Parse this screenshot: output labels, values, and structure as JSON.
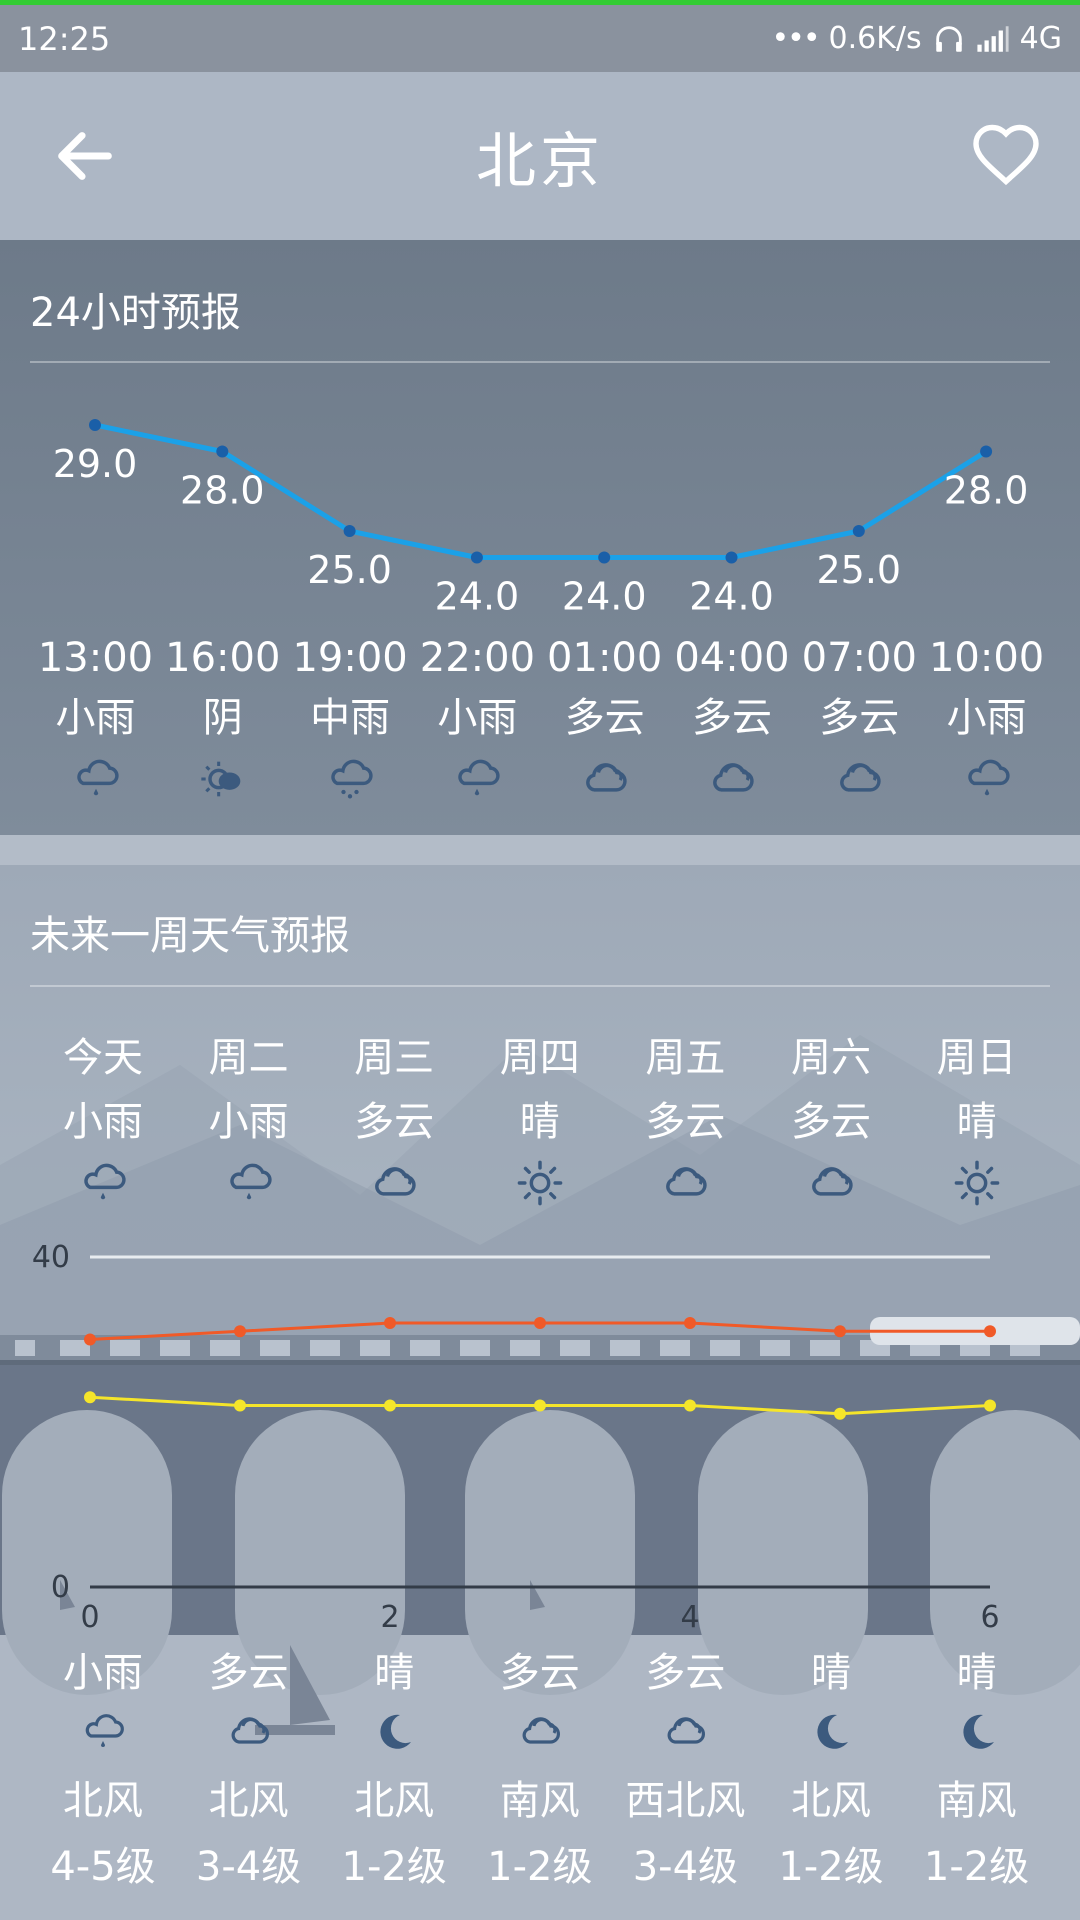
{
  "status_bar": {
    "time": "12:25",
    "net_speed": "0.6K/s",
    "network": "4G"
  },
  "app_bar": {
    "title": "北京",
    "back_icon": "arrow-left-icon",
    "favorite_icon": "heart-icon"
  },
  "hourly": {
    "title": "24小时预报",
    "items": [
      {
        "time": "13:00",
        "cond": "小雨",
        "temp": "29.0",
        "icon": "light-rain-icon"
      },
      {
        "time": "16:00",
        "cond": "阴",
        "temp": "28.0",
        "icon": "overcast-icon"
      },
      {
        "time": "19:00",
        "cond": "中雨",
        "temp": "25.0",
        "icon": "moderate-rain-icon"
      },
      {
        "time": "22:00",
        "cond": "小雨",
        "temp": "24.0",
        "icon": "light-rain-icon"
      },
      {
        "time": "01:00",
        "cond": "多云",
        "temp": "24.0",
        "icon": "cloudy-icon"
      },
      {
        "time": "04:00",
        "cond": "多云",
        "temp": "24.0",
        "icon": "cloudy-icon"
      },
      {
        "time": "07:00",
        "cond": "多云",
        "temp": "25.0",
        "icon": "cloudy-icon"
      },
      {
        "time": "10:00",
        "cond": "小雨",
        "temp": "28.0",
        "icon": "light-rain-icon"
      }
    ],
    "line_color": "#1ba1e8"
  },
  "weekly": {
    "title": "未来一周天气预报",
    "days": [
      {
        "day": "今天",
        "cond": "小雨",
        "day_icon": "light-rain-icon",
        "night_cond": "小雨",
        "night_icon": "light-rain-icon",
        "wind_dir": "北风",
        "wind_lvl": "4-5级"
      },
      {
        "day": "周二",
        "cond": "小雨",
        "day_icon": "light-rain-icon",
        "night_cond": "多云",
        "night_icon": "cloudy-icon",
        "wind_dir": "北风",
        "wind_lvl": "3-4级"
      },
      {
        "day": "周三",
        "cond": "多云",
        "day_icon": "cloudy-icon",
        "night_cond": "晴",
        "night_icon": "moon-icon",
        "wind_dir": "北风",
        "wind_lvl": "1-2级"
      },
      {
        "day": "周四",
        "cond": "晴",
        "day_icon": "sun-icon",
        "night_cond": "多云",
        "night_icon": "cloudy-icon",
        "wind_dir": "南风",
        "wind_lvl": "1-2级"
      },
      {
        "day": "周五",
        "cond": "多云",
        "day_icon": "cloudy-icon",
        "night_cond": "多云",
        "night_icon": "cloudy-icon",
        "wind_dir": "西北风",
        "wind_lvl": "3-4级"
      },
      {
        "day": "周六",
        "cond": "多云",
        "day_icon": "cloudy-icon",
        "night_cond": "晴",
        "night_icon": "moon-icon",
        "wind_dir": "北风",
        "wind_lvl": "1-2级"
      },
      {
        "day": "周日",
        "cond": "晴",
        "day_icon": "sun-icon",
        "night_cond": "晴",
        "night_icon": "moon-icon",
        "wind_dir": "南风",
        "wind_lvl": "1-2级"
      }
    ]
  },
  "chart_data": [
    {
      "type": "line",
      "x": [
        "13:00",
        "16:00",
        "19:00",
        "22:00",
        "01:00",
        "04:00",
        "07:00",
        "10:00"
      ],
      "series": [
        {
          "values": [
            29,
            28,
            25,
            24,
            24,
            24,
            25,
            28
          ]
        }
      ],
      "color": "#1ba1e8"
    },
    {
      "type": "line",
      "x": [
        0,
        1,
        2,
        3,
        4,
        5,
        6
      ],
      "x_ticks": [
        "0",
        "2",
        "4",
        "6"
      ],
      "ylim": [
        0,
        40
      ],
      "y_ticks": [
        "0",
        "40"
      ],
      "series": [
        {
          "values": [
            30,
            31,
            32,
            32,
            32,
            31,
            31
          ],
          "color": "#f05a28"
        },
        {
          "values": [
            23,
            22,
            22,
            22,
            22,
            21,
            22
          ],
          "color": "#f5e52a"
        }
      ]
    }
  ]
}
